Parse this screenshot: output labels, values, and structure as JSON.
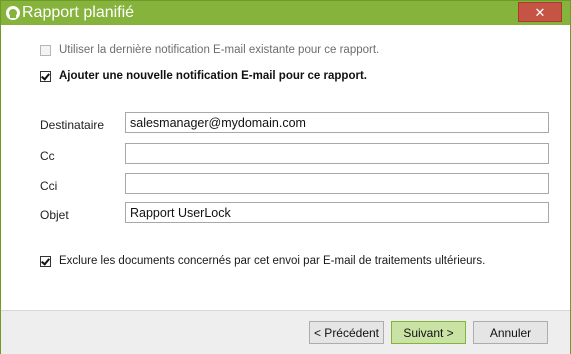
{
  "window": {
    "title": "Rapport planifié",
    "close_glyph": "✕",
    "icons": {
      "app": "app-ring-icon",
      "close": "close-icon"
    }
  },
  "options": {
    "use_existing": {
      "label": "Utiliser la dernière notification E-mail existante pour ce rapport.",
      "checked": false,
      "disabled": true
    },
    "add_new": {
      "label": "Ajouter une nouvelle notification E-mail pour ce rapport.",
      "checked": true
    }
  },
  "fields": {
    "recipient": {
      "label": "Destinataire",
      "value": "salesmanager@mydomain.com"
    },
    "cc": {
      "label": "Cc",
      "value": ""
    },
    "bcc": {
      "label": "Cci",
      "value": ""
    },
    "subject": {
      "label": "Objet",
      "value": "Rapport UserLock"
    }
  },
  "exclude": {
    "label": "Exclure les documents concernés par cet envoi par E-mail de traitements ultérieurs.",
    "checked": true
  },
  "buttons": {
    "previous": "< Précédent",
    "next": "Suivant >",
    "cancel": "Annuler"
  },
  "colors": {
    "accent": "#86b33c",
    "close": "#c65445",
    "primary_button": "#c9e3a4"
  }
}
